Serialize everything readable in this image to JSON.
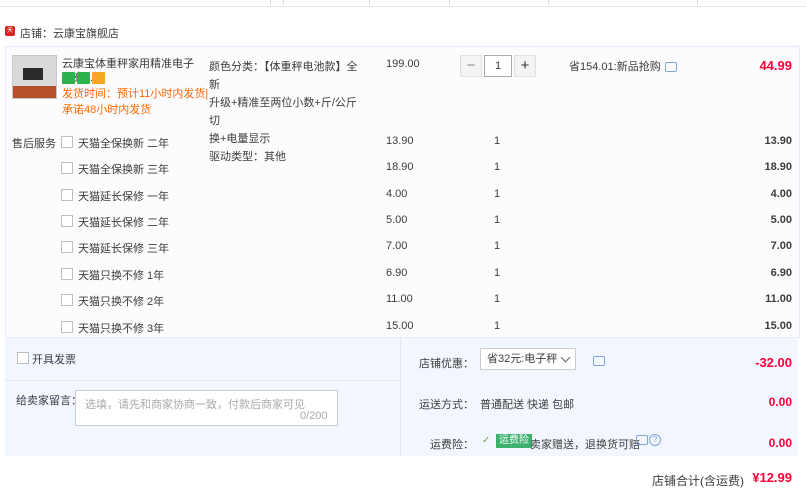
{
  "shop": {
    "tmall_badge": "天猫",
    "label": "店铺：云康宝旗舰店"
  },
  "item": {
    "title": "云康宝体重秤家用精准电子秤充...",
    "shipping_note": "发货时间：预计11小时内发货|承诺48小时内发货",
    "sku_lines": [
      "颜色分类：【体重秤电池款】全新",
      "升级+精准至两位小数+斤/公斤切",
      "换+电量显示",
      "驱动类型：其他"
    ],
    "price": "199.00",
    "quantity": "1",
    "savings": "省154.01:新品抢购",
    "total": "44.99",
    "icon_colors": [
      "#2db14c",
      "#2db14c",
      "#f5a623"
    ]
  },
  "after_sales": {
    "label": "售后服务",
    "rows": [
      {
        "name": "天猫全保换新 二年",
        "price": "13.90",
        "qty": "1",
        "total": "13.90"
      },
      {
        "name": "天猫全保换新 三年",
        "price": "18.90",
        "qty": "1",
        "total": "18.90"
      },
      {
        "name": "天猫延长保修 一年",
        "price": "4.00",
        "qty": "1",
        "total": "4.00"
      },
      {
        "name": "天猫延长保修 二年",
        "price": "5.00",
        "qty": "1",
        "total": "5.00"
      },
      {
        "name": "天猫延长保修 三年",
        "price": "7.00",
        "qty": "1",
        "total": "7.00"
      },
      {
        "name": "天猫只换不修 1年",
        "price": "6.90",
        "qty": "1",
        "total": "6.90"
      },
      {
        "name": "天猫只换不修 2年",
        "price": "11.00",
        "qty": "1",
        "total": "11.00"
      },
      {
        "name": "天猫只换不修 3年",
        "price": "15.00",
        "qty": "1",
        "total": "15.00"
      }
    ]
  },
  "order": {
    "invoice_label": "开具发票",
    "message_label": "给卖家留言：",
    "message_placeholder": "选填，请先和商家协商一致，付款后商家可见",
    "message_count": "0/200",
    "discount_label": "店铺优惠：",
    "coupon_value": "省32元:电子秤",
    "discount_amount": "-32.00",
    "shipping_label": "运送方式：",
    "shipping_method": "普通配送 快递 包邮",
    "shipping_amount": "0.00",
    "insurance_label": "运费险：",
    "insurance_badge": "运费险",
    "insurance_text": "卖家赠送，退换货可赔",
    "insurance_amount": "0.00",
    "total_label": "店铺合计(含运费)",
    "total_amount": "¥12.99"
  },
  "colors": {
    "accent_red": "#ff0036",
    "ship_orange": "#ff6600",
    "panel_blue": "#f2f7ff"
  }
}
